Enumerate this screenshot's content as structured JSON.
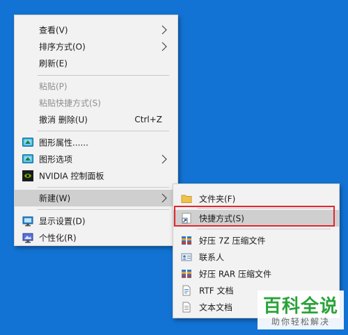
{
  "main_menu": {
    "view": "查看(V)",
    "sort": "排序方式(O)",
    "refresh": "刷新(E)",
    "paste": "粘贴(P)",
    "paste_shortcut": "粘贴快捷方式(S)",
    "undo_delete": "撤消 删除(U)",
    "undo_shortcut": "Ctrl+Z",
    "graphics_properties": "图形属性......",
    "graphics_options": "图形选项",
    "nvidia_panel": "NVIDIA 控制面板",
    "new": "新建(W)",
    "display_settings": "显示设置(D)",
    "personalize": "个性化(R)"
  },
  "new_submenu": {
    "folder": "文件夹(F)",
    "shortcut": "快捷方式(S)",
    "haozip_7z": "好压 7Z 压缩文件",
    "contact": "联系人",
    "haozip_rar": "好压 RAR 压缩文件",
    "rtf_doc": "RTF 文档",
    "text_doc": "文本文档"
  },
  "watermark": {
    "title": "百科全说",
    "subtitle": "助你轻松解决"
  },
  "colors": {
    "desktop": "#1273d4",
    "menu_bg": "#f2f2f2",
    "hover": "#cfcfcf",
    "highlight_border": "#e2262c",
    "watermark_green": "#2aa23a"
  }
}
